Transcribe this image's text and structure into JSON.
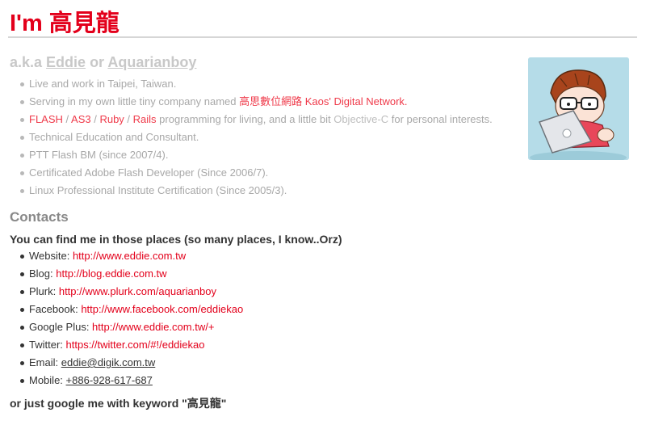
{
  "header": {
    "title": "I'm 高見龍"
  },
  "aka": {
    "prefix": "a.k.a ",
    "name1": "Eddie",
    "or": " or ",
    "name2": "Aquarianboy"
  },
  "intro": {
    "items": [
      "Live and work in Taipei, Taiwan."
    ],
    "company_prefix": "Serving in my own little tiny company named ",
    "company_cn": "高思數位網路",
    "company_space": " ",
    "company_en": "Kaos' Digital Network.",
    "skills": {
      "flash": "FLASH",
      "sep": " / ",
      "as3": "AS3",
      "ruby": "Ruby",
      "rails": "Rails",
      "middle": " programming for living, and a little bit ",
      "objc": "Objective-C",
      "end": " for personal interests."
    },
    "more": [
      "Technical Education and Consultant.",
      "PTT Flash BM (since 2007/4).",
      "Certificated Adobe Flash Developer (Since 2006/7).",
      "Linux Professional Institute Certification (Since 2005/3)."
    ]
  },
  "contacts": {
    "heading": "Contacts",
    "subheading": "You can find me in those places (so many places, I know..Orz)",
    "items": [
      {
        "label": "Website: ",
        "value": "http://www.eddie.com.tw"
      },
      {
        "label": "Blog: ",
        "value": "http://blog.eddie.com.tw"
      },
      {
        "label": "Plurk: ",
        "value": "http://www.plurk.com/aquarianboy"
      },
      {
        "label": "Facebook: ",
        "value": "http://www.facebook.com/eddiekao"
      },
      {
        "label": "Google Plus: ",
        "value": "http://www.eddie.com.tw/+"
      },
      {
        "label": "Twitter: ",
        "value": "https://twitter.com/#!/eddiekao"
      },
      {
        "label": "Email: ",
        "value": "eddie@digik.com.tw"
      },
      {
        "label": "Mobile: ",
        "value": "+886-928-617-687"
      }
    ]
  },
  "footer": {
    "google_text": "or just google me with keyword \"高見龍\""
  },
  "avatar": {
    "icon": "cartoon-avatar-with-laptop-icon"
  }
}
